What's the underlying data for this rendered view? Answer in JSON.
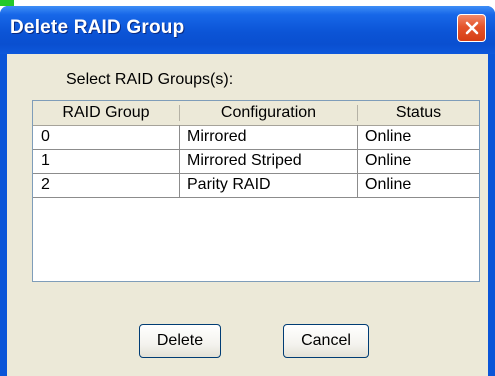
{
  "window": {
    "title": "Delete RAID Group"
  },
  "dialog": {
    "prompt": "Select RAID Groups(s):",
    "columns": [
      "RAID Group",
      "Configuration",
      "Status"
    ],
    "rows": [
      [
        "0",
        "Mirrored",
        "Online"
      ],
      [
        "1",
        "Mirrored Striped",
        "Online"
      ],
      [
        "2",
        "Parity RAID",
        "Online"
      ]
    ]
  },
  "buttons": {
    "delete": "Delete",
    "cancel": "Cancel"
  }
}
